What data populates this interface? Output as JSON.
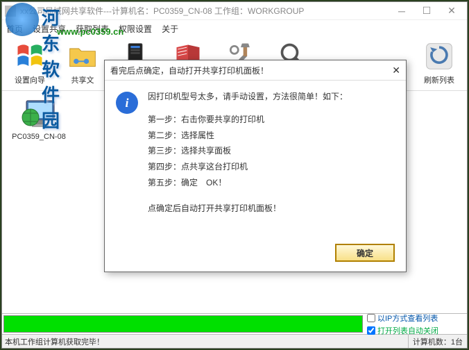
{
  "titlebar": {
    "title": "xx公司局域网共享软件---计算机名：PC0359_CN-08  工作组：WORKGROUP"
  },
  "menu": {
    "m1": "首页",
    "m2": "设置共享",
    "m3": "获取列表",
    "m4": "权限设置",
    "m5": "关于"
  },
  "watermark": {
    "text": "河东软件园",
    "url": "www.pc0359.cn"
  },
  "toolbar": {
    "t1": "设置向导",
    "t2": "共享文",
    "t6": "刷新列表"
  },
  "desktop": {
    "item1": "PC0359_CN-08"
  },
  "checks": {
    "c1": "以IP方式查看列表",
    "c2": "打开列表自动关闭"
  },
  "status": {
    "left": "本机工作组计算机获取完毕！",
    "right": "计算机数：1台"
  },
  "dialog": {
    "title": "看完后点确定，自动打开共享打印机面板！",
    "lead": "因打印机型号太多，请手动设置，方法很简单！如下：",
    "s1": "第一步：右击你要共享的打印机",
    "s2": "第二步：选择属性",
    "s3": "第三步：选择共享面板",
    "s4": "第四步：点共享这台打印机",
    "s5": "第五步：确定　OK！",
    "tail": "点确定后自动打开共享打印机面板！",
    "ok": "确定"
  }
}
